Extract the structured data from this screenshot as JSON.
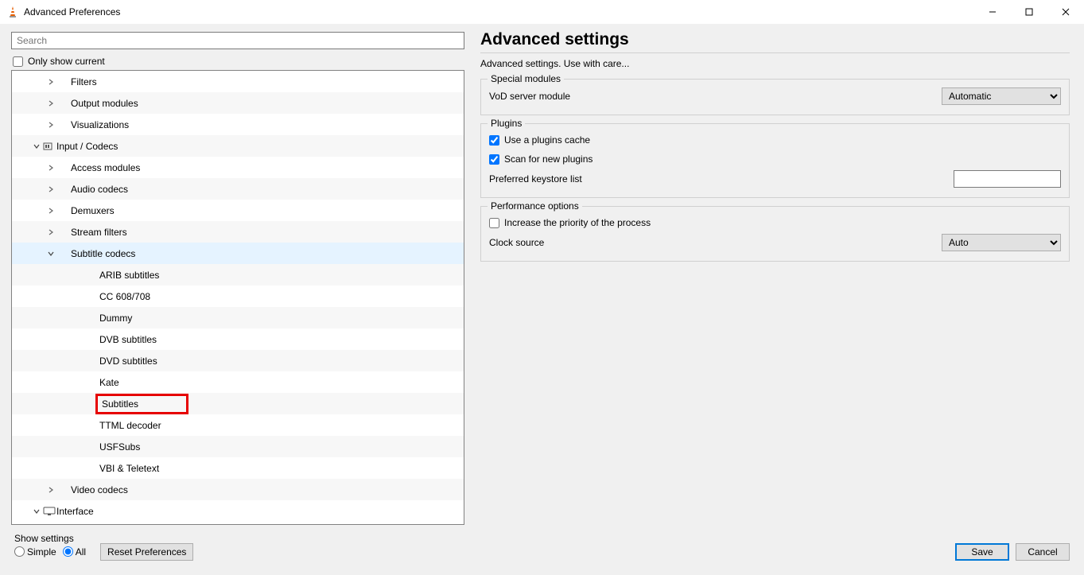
{
  "window": {
    "title": "Advanced Preferences"
  },
  "left": {
    "search_placeholder": "Search",
    "only_show_current": "Only show current",
    "tree": [
      {
        "label": "Filters",
        "indent": 1,
        "chevron": "right"
      },
      {
        "label": "Output modules",
        "indent": 1,
        "chevron": "right"
      },
      {
        "label": "Visualizations",
        "indent": 1,
        "chevron": "right"
      },
      {
        "label": "Input / Codecs",
        "indent": 0,
        "chevron": "down",
        "icon": "codecs"
      },
      {
        "label": "Access modules",
        "indent": 1,
        "chevron": "right"
      },
      {
        "label": "Audio codecs",
        "indent": 1,
        "chevron": "right"
      },
      {
        "label": "Demuxers",
        "indent": 1,
        "chevron": "right"
      },
      {
        "label": "Stream filters",
        "indent": 1,
        "chevron": "right"
      },
      {
        "label": "Subtitle codecs",
        "indent": 1,
        "chevron": "down",
        "selected": true
      },
      {
        "label": "ARIB subtitles",
        "indent": 3
      },
      {
        "label": "CC 608/708",
        "indent": 3
      },
      {
        "label": "Dummy",
        "indent": 3
      },
      {
        "label": "DVB subtitles",
        "indent": 3
      },
      {
        "label": "DVD subtitles",
        "indent": 3
      },
      {
        "label": "Kate",
        "indent": 3
      },
      {
        "label": "Subtitles",
        "indent": 3,
        "highlight": true
      },
      {
        "label": "TTML decoder",
        "indent": 3
      },
      {
        "label": "USFSubs",
        "indent": 3
      },
      {
        "label": "VBI & Teletext",
        "indent": 3
      },
      {
        "label": "Video codecs",
        "indent": 1,
        "chevron": "right"
      },
      {
        "label": "Interface",
        "indent": 0,
        "chevron": "down",
        "icon": "interface"
      }
    ]
  },
  "right": {
    "heading": "Advanced settings",
    "subtitle": "Advanced settings. Use with care...",
    "group_special": {
      "legend": "Special modules",
      "vod_label": "VoD server module",
      "vod_value": "Automatic"
    },
    "group_plugins": {
      "legend": "Plugins",
      "use_cache": "Use a plugins cache",
      "scan_new": "Scan for new plugins",
      "keystore_label": "Preferred keystore list"
    },
    "group_perf": {
      "legend": "Performance options",
      "increase_priority": "Increase the priority of the process",
      "clock_label": "Clock source",
      "clock_value": "Auto"
    }
  },
  "footer": {
    "show_settings": "Show settings",
    "simple": "Simple",
    "all": "All",
    "reset": "Reset Preferences",
    "save": "Save",
    "cancel": "Cancel"
  }
}
